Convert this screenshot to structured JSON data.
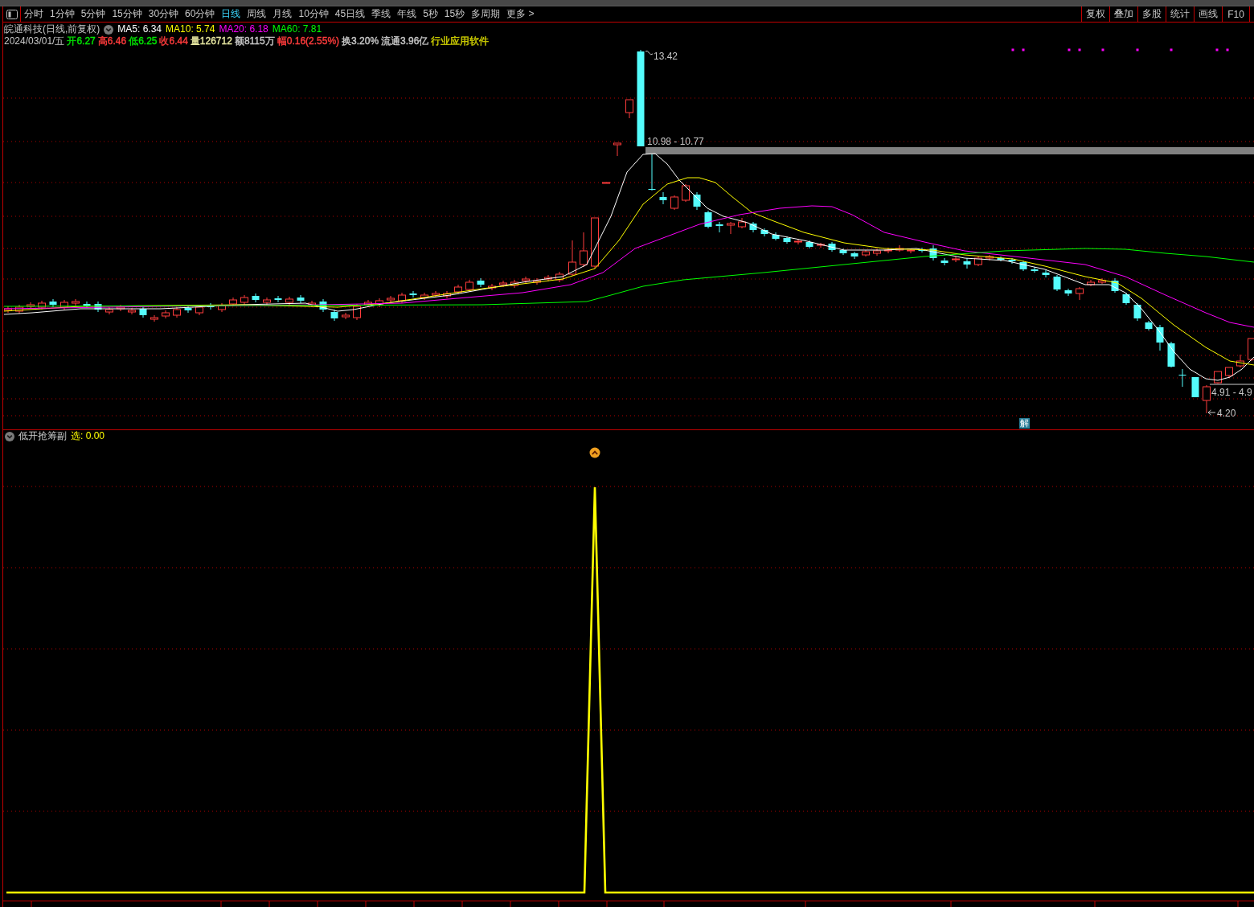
{
  "toolbar": {
    "periods": [
      {
        "label": "分时",
        "selected": false
      },
      {
        "label": "1分钟",
        "selected": false
      },
      {
        "label": "5分钟",
        "selected": false
      },
      {
        "label": "15分钟",
        "selected": false
      },
      {
        "label": "30分钟",
        "selected": false
      },
      {
        "label": "60分钟",
        "selected": false
      },
      {
        "label": "日线",
        "selected": true
      },
      {
        "label": "周线",
        "selected": false
      },
      {
        "label": "月线",
        "selected": false
      },
      {
        "label": "10分钟",
        "selected": false
      },
      {
        "label": "45日线",
        "selected": false
      },
      {
        "label": "季线",
        "selected": false
      },
      {
        "label": "年线",
        "selected": false
      },
      {
        "label": "5秒",
        "selected": false
      },
      {
        "label": "15秒",
        "selected": false
      },
      {
        "label": "多周期",
        "selected": false
      }
    ],
    "more": "更多 >",
    "tools": [
      "复权",
      "叠加",
      "多股",
      "统计",
      "画线",
      "F10"
    ]
  },
  "price_pane": {
    "title": "皖通科技(日线,前复权)",
    "moving_averages": [
      {
        "label": "MA5: 6.34",
        "color": "#ffffff"
      },
      {
        "label": "MA10: 5.74",
        "color": "#ffff00"
      },
      {
        "label": "MA20: 6.18",
        "color": "#ff00ff"
      },
      {
        "label": "MA60: 7.81",
        "color": "#00ff00"
      }
    ],
    "date": "2024/03/01/五",
    "quote_fields": [
      {
        "text": "开6.27",
        "color": "#00e600"
      },
      {
        "text": "高6.46",
        "color": "#ff3c3c"
      },
      {
        "text": "低6.25",
        "color": "#00e600"
      },
      {
        "text": "收6.44",
        "color": "#ff3c3c"
      },
      {
        "text": "量126712",
        "color": "#e6e6a0"
      },
      {
        "text": "额8115万",
        "color": "#c8c8c8"
      },
      {
        "text": "幅0.16(2.55%)",
        "color": "#ff3c3c"
      },
      {
        "text": "换3.20%",
        "color": "#c8c8c8"
      },
      {
        "text": "流通3.96亿",
        "color": "#c8c8c8"
      },
      {
        "text": "行业应用软件",
        "color": "#d2d200"
      }
    ],
    "annotations": [
      {
        "kind": "high",
        "text": "13.42"
      },
      {
        "kind": "gap_top",
        "text": "10.98 - 10.77"
      },
      {
        "kind": "gap_bottom",
        "text": "4.91 - 4.9"
      },
      {
        "kind": "low",
        "text": "4.20"
      }
    ],
    "badge": "解"
  },
  "indicator_pane": {
    "title": "低开抢筹副",
    "value": "选: 0.00"
  }
}
